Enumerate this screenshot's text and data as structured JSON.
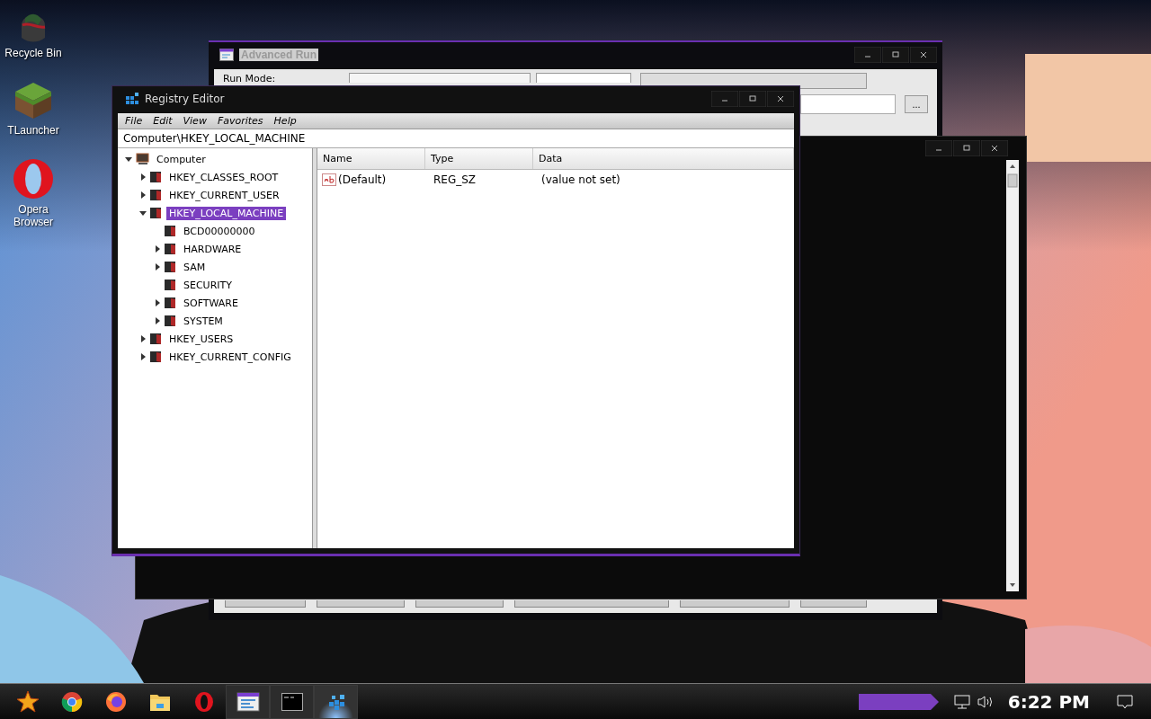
{
  "desktop_icons": [
    {
      "kind": "recycle",
      "label": "Recycle Bin"
    },
    {
      "kind": "cube",
      "label": "TLauncher"
    },
    {
      "kind": "opera",
      "label": "Opera Browser"
    }
  ],
  "background_window": {
    "title": "Advanced Run",
    "run_mode_label": "Run Mode:",
    "browse_button": "..."
  },
  "registry_editor": {
    "title": "Registry Editor",
    "menu": [
      "File",
      "Edit",
      "View",
      "Favorites",
      "Help"
    ],
    "address": "Computer\\HKEY_LOCAL_MACHINE",
    "tree": [
      {
        "kind": "computer",
        "label": "Computer",
        "expanded": true,
        "selected": false,
        "children": [
          {
            "kind": "key",
            "label": "HKEY_CLASSES_ROOT",
            "expanded": false,
            "selected": false
          },
          {
            "kind": "key",
            "label": "HKEY_CURRENT_USER",
            "expanded": false,
            "selected": false
          },
          {
            "kind": "key",
            "label": "HKEY_LOCAL_MACHINE",
            "expanded": true,
            "selected": true,
            "children": [
              {
                "kind": "key",
                "label": "BCD00000000",
                "selected": false
              },
              {
                "kind": "key",
                "label": "HARDWARE",
                "expanded": false,
                "selected": false
              },
              {
                "kind": "key",
                "label": "SAM",
                "expanded": false,
                "selected": false
              },
              {
                "kind": "key",
                "label": "SECURITY",
                "selected": false
              },
              {
                "kind": "key",
                "label": "SOFTWARE",
                "expanded": false,
                "selected": false
              },
              {
                "kind": "key",
                "label": "SYSTEM",
                "expanded": false,
                "selected": false
              }
            ]
          },
          {
            "kind": "key",
            "label": "HKEY_USERS",
            "expanded": false,
            "selected": false
          },
          {
            "kind": "key",
            "label": "HKEY_CURRENT_CONFIG",
            "expanded": false,
            "selected": false
          }
        ]
      }
    ],
    "columns": [
      "Name",
      "Type",
      "Data"
    ],
    "rows": [
      {
        "name": "(Default)",
        "type": "REG_SZ",
        "data": "(value not set)"
      }
    ]
  },
  "taskbar": {
    "apps": [
      {
        "kind": "start",
        "open": false,
        "selected": false
      },
      {
        "kind": "chrome",
        "open": false,
        "selected": false
      },
      {
        "kind": "firefox",
        "open": false,
        "selected": false
      },
      {
        "kind": "folder",
        "open": false,
        "selected": false
      },
      {
        "kind": "opera",
        "open": false,
        "selected": false
      },
      {
        "kind": "window",
        "open": true,
        "selected": false
      },
      {
        "kind": "terminal",
        "open": true,
        "selected": false
      },
      {
        "kind": "registry",
        "open": true,
        "selected": true
      }
    ],
    "clock": "6:22 PM"
  }
}
